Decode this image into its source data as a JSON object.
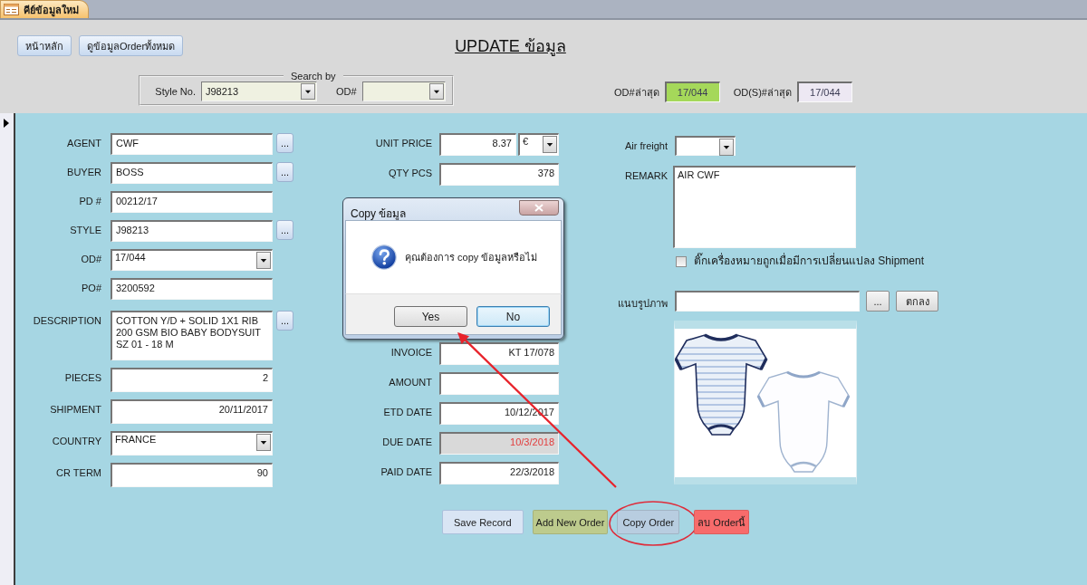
{
  "tabs": [
    {
      "label": "คีย์ข้อมูลใหม่",
      "selected": true
    }
  ],
  "header": {
    "buttons": [
      "หน้าหลัก",
      "ดูข้อมูลOrderทั้งหมด"
    ],
    "title": "UPDATE ข้อมูล",
    "search": {
      "legend": "Search by",
      "fields": [
        {
          "label": "Style No.",
          "value": "J98213"
        },
        {
          "label": "OD#"
        }
      ]
    },
    "latest": [
      {
        "label": "OD#ล่าสุด",
        "value": "17/044",
        "color": "#a5d85a"
      },
      {
        "label": "OD(S)#ล่าสุด",
        "value": "17/044",
        "color": "#ede8f3"
      }
    ]
  },
  "left_fields": [
    {
      "label": "AGENT",
      "kind": "text",
      "value": "CWF",
      "button": "..."
    },
    {
      "label": "BUYER",
      "kind": "text",
      "value": "BOSS",
      "button": "..."
    },
    {
      "label": "PD #",
      "kind": "text",
      "value": "00212/17"
    },
    {
      "label": "STYLE",
      "kind": "text",
      "value": "J98213",
      "button": "..."
    },
    {
      "label": "OD#",
      "kind": "combo",
      "value": "17/044"
    },
    {
      "label": "PO#",
      "kind": "text",
      "value": "3200592"
    },
    {
      "label": "DESCRIPTION",
      "kind": "memo",
      "value": "COTTON Y/D + SOLID 1X1 RIB\n200 GSM BIO BABY BODYSUIT\nSZ 01 - 18 M",
      "button": "..."
    },
    {
      "label": "PIECES",
      "kind": "numeric",
      "value": "2"
    },
    {
      "label": "SHIPMENT",
      "kind": "numeric",
      "value": "20/11/2017"
    },
    {
      "label": "COUNTRY",
      "kind": "combo",
      "value": "FRANCE"
    },
    {
      "label": "CR TERM",
      "kind": "numeric",
      "value": "90"
    }
  ],
  "middle_fields": [
    {
      "label": "UNIT PRICE",
      "kind": "numeric",
      "value": "8.37",
      "currency": "€",
      "locked": false
    },
    {
      "label": "QTY PCS",
      "kind": "numeric",
      "value": "378",
      "locked": false
    },
    {
      "label": "INVOICE",
      "kind": "numeric",
      "value": "KT 17/078",
      "locked": false
    },
    {
      "label": "AMOUNT",
      "kind": "numeric",
      "locked": false
    },
    {
      "label": "ETD DATE",
      "kind": "numeric",
      "value": "10/12/2017",
      "locked": false
    },
    {
      "label": "DUE DATE",
      "kind": "numeric",
      "value": "10/3/2018",
      "locked": true
    },
    {
      "label": "PAID DATE",
      "kind": "numeric",
      "value": "22/3/2018",
      "locked": false
    }
  ],
  "right": {
    "air_freight": {
      "label": "Air freight"
    },
    "remark": {
      "label": "REMARK",
      "value": "AIR CWF"
    },
    "shipment_check": {
      "label": "ติ๊กเครื่องหมายถูกเมื่อมีการเปลี่ยนแปลง Shipment",
      "checked": false
    },
    "attachment": {
      "label": "แนบรูปภาพ",
      "browse_button": "...",
      "ok_button": "ตกลง"
    }
  },
  "actions": [
    {
      "label": "Save Record",
      "color": "#d9e5f4",
      "circled": false
    },
    {
      "label": "Add New Order",
      "color": "#bdcb8d",
      "circled": false
    },
    {
      "label": "Copy Order",
      "color": "#b8cde0",
      "circled": true
    },
    {
      "label": "ลบ Orderนี้",
      "color": "#f76b6b",
      "circled": false
    }
  ],
  "dialog": {
    "title": "Copy ข้อมูล",
    "message": "คุณต้องการ copy ข้อมูลหรือไม่",
    "buttons": [
      {
        "label": "Yes",
        "focused": false
      },
      {
        "label": "No",
        "focused": true
      }
    ]
  }
}
